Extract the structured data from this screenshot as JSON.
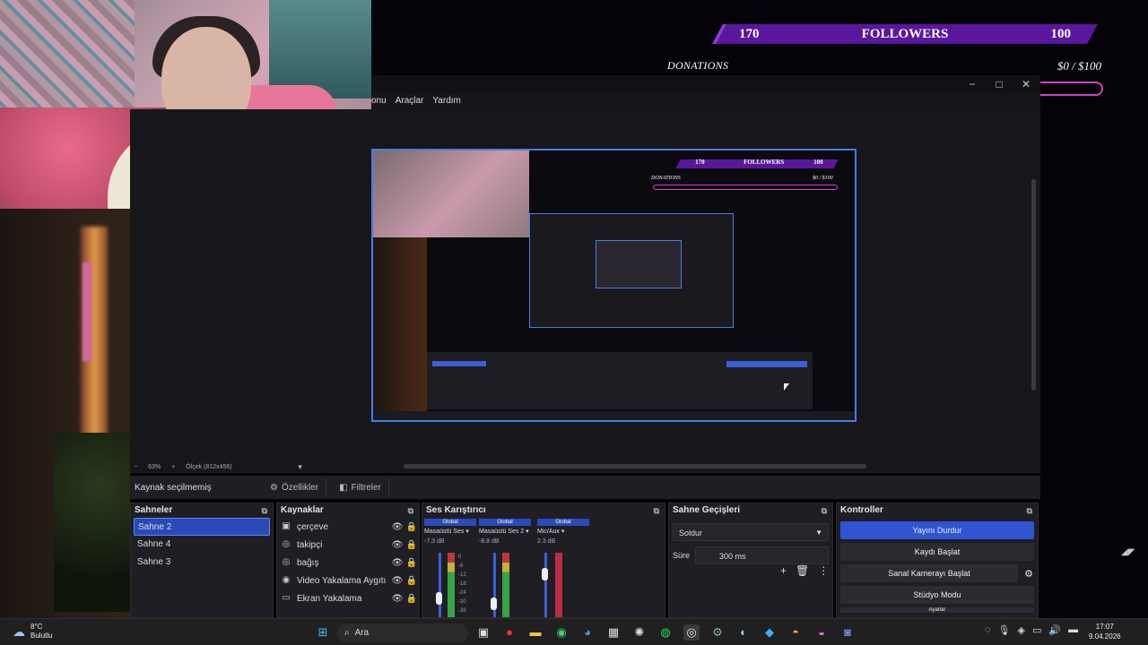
{
  "overlay": {
    "followers_current": "170",
    "followers_label": "FOLLOWERS",
    "followers_goal": "100",
    "donations_label": "DONATIONS",
    "donations_value": "$0 / $100"
  },
  "obs": {
    "menu": [
      "onu",
      "Araçlar",
      "Yardım"
    ],
    "window_buttons": {
      "minimize": "−",
      "maximize": "□",
      "close": "✕"
    },
    "zoom": {
      "minus": "−",
      "level": "63%",
      "plus": "+",
      "canvas": "Ölçek (812x456)"
    },
    "source_toolbar": {
      "no_selection": "Kaynak seçilmemiş",
      "properties": "Özellikler",
      "filters": "Filtreler"
    },
    "scenes": {
      "title": "Sahneler",
      "items": [
        "Sahne 2",
        "Sahne 4",
        "Sahne 3"
      ],
      "active": "Sahne 2"
    },
    "sources": {
      "title": "Kaynaklar",
      "items": [
        {
          "label": "çerçeve",
          "icon": "image-icon"
        },
        {
          "label": "takipçi",
          "icon": "browser-icon"
        },
        {
          "label": "bağış",
          "icon": "browser-icon"
        },
        {
          "label": "Video Yakalama Aygıtı",
          "icon": "camera-icon"
        },
        {
          "label": "Ekran Yakalama",
          "icon": "monitor-icon"
        }
      ]
    },
    "mixer": {
      "title": "Ses Karıştırıcı",
      "channels": [
        {
          "global": "Global",
          "name": "Masaüstü Ses",
          "db": "-7.3 dB"
        },
        {
          "global": "Global",
          "name": "Masaüstü Ses 2",
          "db": "-8.8 dB"
        },
        {
          "global": "Global",
          "name": "Mic/Aux",
          "db": "2.3 dB"
        }
      ],
      "scale": [
        "0",
        "-6",
        "-12",
        "-18",
        "-24",
        "-30",
        "-36"
      ]
    },
    "transitions": {
      "title": "Sahne Geçişleri",
      "selected": "Soldur",
      "duration_label": "Süre",
      "duration_value": "300 ms"
    },
    "controls": {
      "title": "Kontroller",
      "stop_stream": "Yayını Durdur",
      "start_recording": "Kaydı Başlat",
      "start_virtual_cam": "Sanal Kamerayı Başlat",
      "studio_mode": "Stüdyo Modu",
      "settings": "Ayarlar"
    }
  },
  "taskbar": {
    "weather_temp": "8°C",
    "weather_desc": "Bulutlu",
    "search_placeholder": "Ara",
    "time": "17:07",
    "date": "9.04.2026"
  },
  "colors": {
    "accent": "#2f55d4",
    "followers_bar": "#5a169d",
    "donations_border": "#d43fc6"
  }
}
